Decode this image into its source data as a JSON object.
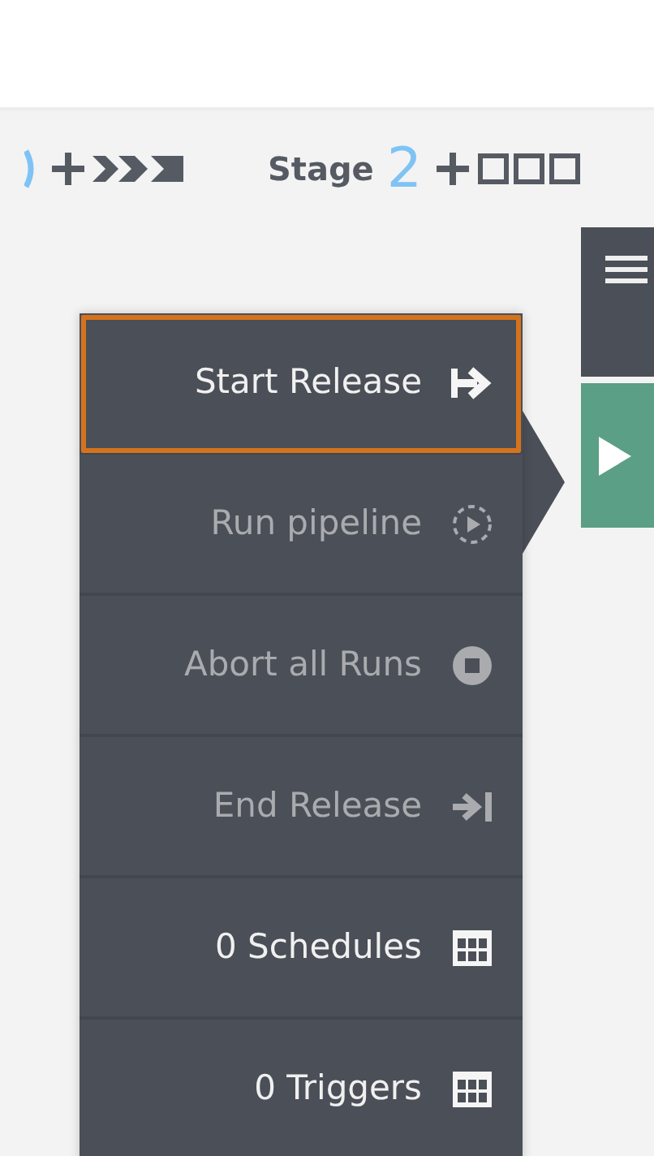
{
  "header": {
    "stage_label": "Stage",
    "stage_number": "2"
  },
  "menu": [
    {
      "label": "Start Release",
      "kind": "start",
      "selected": true,
      "disabled": false
    },
    {
      "label": "Run pipeline",
      "kind": "run",
      "selected": false,
      "disabled": true
    },
    {
      "label": "Abort all Runs",
      "kind": "abort",
      "selected": false,
      "disabled": true
    },
    {
      "label": "End Release",
      "kind": "end",
      "selected": false,
      "disabled": true
    },
    {
      "label": "0 Schedules",
      "kind": "grid",
      "selected": false,
      "disabled": false
    },
    {
      "label": "0 Triggers",
      "kind": "grid",
      "selected": false,
      "disabled": false
    }
  ]
}
